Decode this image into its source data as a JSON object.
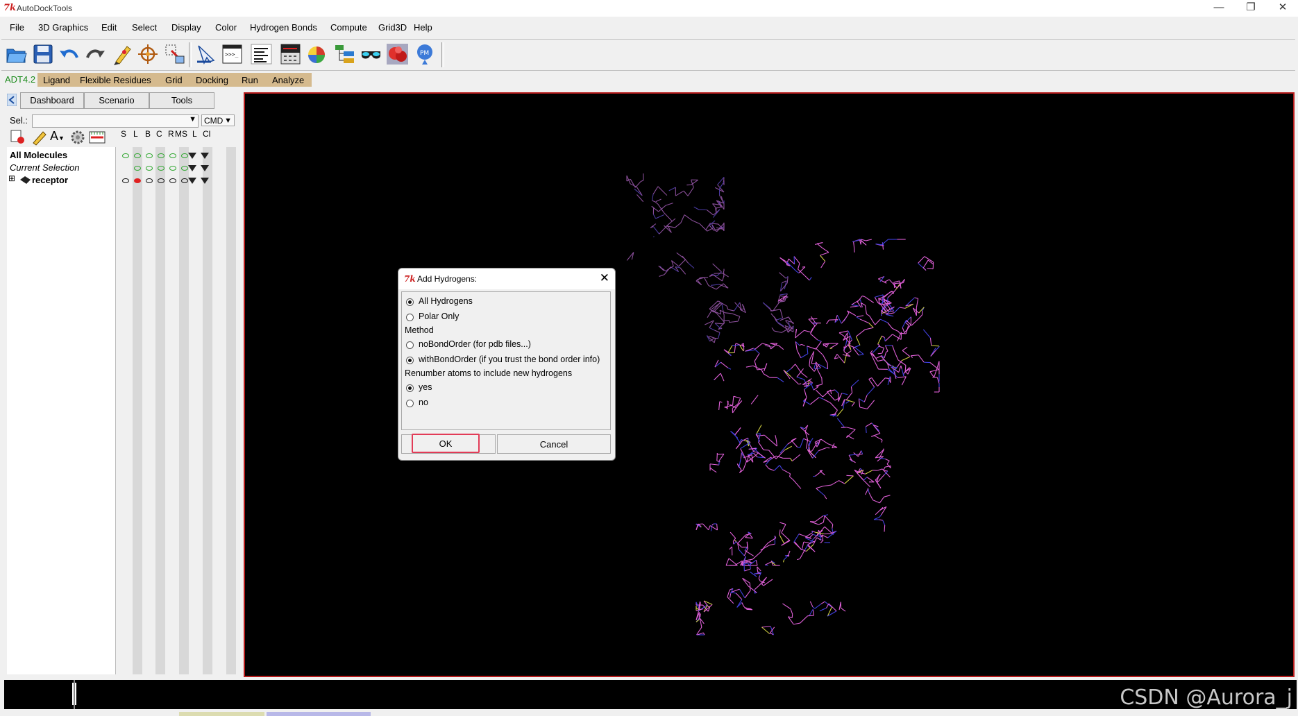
{
  "window": {
    "title": "AutoDockTools",
    "tk_logo": "7k"
  },
  "menubar": [
    "File",
    "3D Graphics",
    "Edit",
    "Select",
    "Display",
    "Color",
    "Hydrogen Bonds",
    "Compute",
    "Grid3D",
    "Help"
  ],
  "toolbar": [
    "open-folder-icon",
    "save-disk-icon",
    "undo-arrow-icon",
    "redo-arrow-icon",
    "pencil-icon",
    "crosshair-icon",
    "selection-icon",
    "pointer-hand-icon",
    "python-shell-icon",
    "text-lines-icon",
    "dashboard-icon",
    "color-spheres-icon",
    "tree-list-icon",
    "stereo-glasses-icon",
    "red-molecule-icon",
    "pmv-logo-icon"
  ],
  "adt_menu": {
    "active": "ADT4.2",
    "items": [
      "Ligand",
      "Flexible Residues",
      "Grid",
      "Docking",
      "Run",
      "Analyze"
    ]
  },
  "left_panel": {
    "tabs": [
      "Dashboard",
      "Scenario",
      "Tools"
    ],
    "sel_label": "Sel.:",
    "sel_value": "",
    "cmd_value": "CMD",
    "column_headers": [
      "S",
      "L",
      "B",
      "C",
      "R",
      "MS",
      "L",
      "Cl"
    ],
    "tree": [
      {
        "label": "All Molecules",
        "style": "bold"
      },
      {
        "label": "Current Selection",
        "style": "italic"
      },
      {
        "label": "receptor",
        "style": "bold",
        "expander": "⊞"
      }
    ]
  },
  "dialog": {
    "title": "Add Hydrogens:",
    "close_glyph": "✕",
    "options": [
      {
        "label": "All Hydrogens",
        "checked": true
      },
      {
        "label": "Polar Only",
        "checked": false
      }
    ],
    "method_heading": "Method",
    "method_options": [
      {
        "label": "noBondOrder (for pdb files...)",
        "checked": false
      },
      {
        "label": "withBondOrder (if you trust the bond order info)",
        "checked": true
      }
    ],
    "renumber_heading": "Renumber atoms to include new hydrogens",
    "renumber_options": [
      {
        "label": "yes",
        "checked": true
      },
      {
        "label": "no",
        "checked": false
      }
    ],
    "ok_label": "OK",
    "cancel_label": "Cancel"
  },
  "watermark": "CSDN @Aurora_j",
  "colors": {
    "viewer_border": "#b71c1c",
    "molecule_pink": "#e060d8",
    "molecule_blue": "#4040e0",
    "ok_highlight": "#e23b57",
    "adt_bar": "#d5ba8e"
  }
}
